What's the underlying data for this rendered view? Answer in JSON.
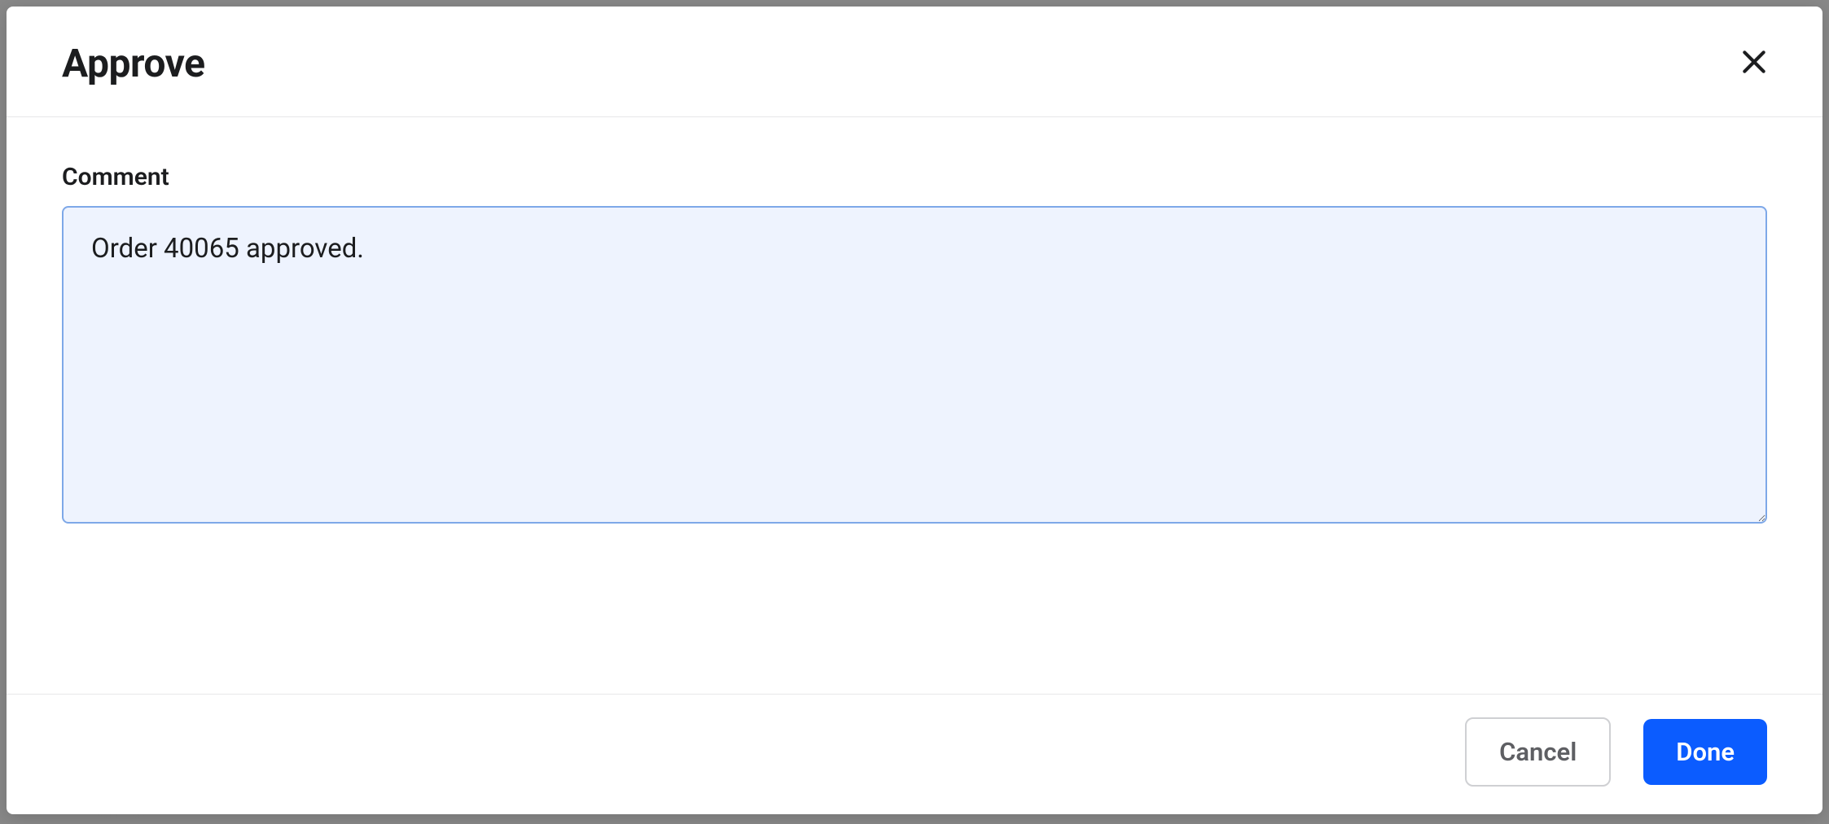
{
  "modal": {
    "title": "Approve",
    "comment": {
      "label": "Comment",
      "value": "Order 40065 approved."
    },
    "buttons": {
      "cancel": "Cancel",
      "done": "Done"
    }
  },
  "background": {
    "hint": "en-us"
  }
}
